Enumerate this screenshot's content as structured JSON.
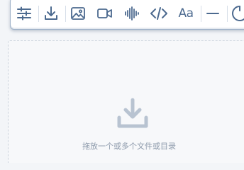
{
  "toolbar": {
    "items": [
      {
        "icon": "sliders-icon"
      },
      {
        "icon": "download-icon"
      },
      {
        "icon": "image-icon"
      },
      {
        "icon": "video-icon"
      },
      {
        "icon": "audio-waveform-icon"
      },
      {
        "icon": "code-icon"
      },
      {
        "icon": "font-icon",
        "label": "Aa"
      },
      {
        "icon": "horizontal-rule-icon"
      },
      {
        "icon": "spinner-icon"
      }
    ],
    "accent_color": "#4c6a8f"
  },
  "dropzone": {
    "icon": "download-icon",
    "hint": "拖放一个或多个文件或目录"
  }
}
